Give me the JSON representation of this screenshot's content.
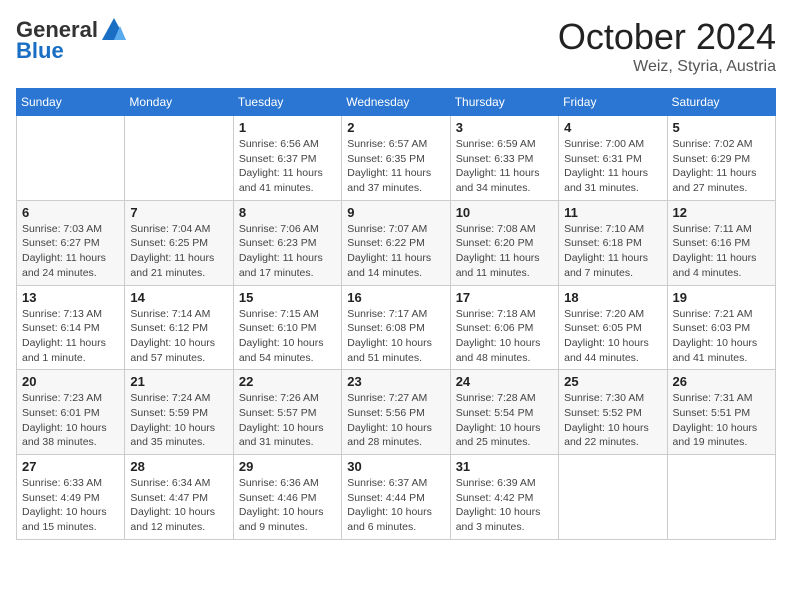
{
  "header": {
    "logo_general": "General",
    "logo_blue": "Blue",
    "month_title": "October 2024",
    "location": "Weiz, Styria, Austria"
  },
  "days_of_week": [
    "Sunday",
    "Monday",
    "Tuesday",
    "Wednesday",
    "Thursday",
    "Friday",
    "Saturday"
  ],
  "weeks": [
    [
      {
        "day": "",
        "info": ""
      },
      {
        "day": "",
        "info": ""
      },
      {
        "day": "1",
        "info": "Sunrise: 6:56 AM\nSunset: 6:37 PM\nDaylight: 11 hours and 41 minutes."
      },
      {
        "day": "2",
        "info": "Sunrise: 6:57 AM\nSunset: 6:35 PM\nDaylight: 11 hours and 37 minutes."
      },
      {
        "day": "3",
        "info": "Sunrise: 6:59 AM\nSunset: 6:33 PM\nDaylight: 11 hours and 34 minutes."
      },
      {
        "day": "4",
        "info": "Sunrise: 7:00 AM\nSunset: 6:31 PM\nDaylight: 11 hours and 31 minutes."
      },
      {
        "day": "5",
        "info": "Sunrise: 7:02 AM\nSunset: 6:29 PM\nDaylight: 11 hours and 27 minutes."
      }
    ],
    [
      {
        "day": "6",
        "info": "Sunrise: 7:03 AM\nSunset: 6:27 PM\nDaylight: 11 hours and 24 minutes."
      },
      {
        "day": "7",
        "info": "Sunrise: 7:04 AM\nSunset: 6:25 PM\nDaylight: 11 hours and 21 minutes."
      },
      {
        "day": "8",
        "info": "Sunrise: 7:06 AM\nSunset: 6:23 PM\nDaylight: 11 hours and 17 minutes."
      },
      {
        "day": "9",
        "info": "Sunrise: 7:07 AM\nSunset: 6:22 PM\nDaylight: 11 hours and 14 minutes."
      },
      {
        "day": "10",
        "info": "Sunrise: 7:08 AM\nSunset: 6:20 PM\nDaylight: 11 hours and 11 minutes."
      },
      {
        "day": "11",
        "info": "Sunrise: 7:10 AM\nSunset: 6:18 PM\nDaylight: 11 hours and 7 minutes."
      },
      {
        "day": "12",
        "info": "Sunrise: 7:11 AM\nSunset: 6:16 PM\nDaylight: 11 hours and 4 minutes."
      }
    ],
    [
      {
        "day": "13",
        "info": "Sunrise: 7:13 AM\nSunset: 6:14 PM\nDaylight: 11 hours and 1 minute."
      },
      {
        "day": "14",
        "info": "Sunrise: 7:14 AM\nSunset: 6:12 PM\nDaylight: 10 hours and 57 minutes."
      },
      {
        "day": "15",
        "info": "Sunrise: 7:15 AM\nSunset: 6:10 PM\nDaylight: 10 hours and 54 minutes."
      },
      {
        "day": "16",
        "info": "Sunrise: 7:17 AM\nSunset: 6:08 PM\nDaylight: 10 hours and 51 minutes."
      },
      {
        "day": "17",
        "info": "Sunrise: 7:18 AM\nSunset: 6:06 PM\nDaylight: 10 hours and 48 minutes."
      },
      {
        "day": "18",
        "info": "Sunrise: 7:20 AM\nSunset: 6:05 PM\nDaylight: 10 hours and 44 minutes."
      },
      {
        "day": "19",
        "info": "Sunrise: 7:21 AM\nSunset: 6:03 PM\nDaylight: 10 hours and 41 minutes."
      }
    ],
    [
      {
        "day": "20",
        "info": "Sunrise: 7:23 AM\nSunset: 6:01 PM\nDaylight: 10 hours and 38 minutes."
      },
      {
        "day": "21",
        "info": "Sunrise: 7:24 AM\nSunset: 5:59 PM\nDaylight: 10 hours and 35 minutes."
      },
      {
        "day": "22",
        "info": "Sunrise: 7:26 AM\nSunset: 5:57 PM\nDaylight: 10 hours and 31 minutes."
      },
      {
        "day": "23",
        "info": "Sunrise: 7:27 AM\nSunset: 5:56 PM\nDaylight: 10 hours and 28 minutes."
      },
      {
        "day": "24",
        "info": "Sunrise: 7:28 AM\nSunset: 5:54 PM\nDaylight: 10 hours and 25 minutes."
      },
      {
        "day": "25",
        "info": "Sunrise: 7:30 AM\nSunset: 5:52 PM\nDaylight: 10 hours and 22 minutes."
      },
      {
        "day": "26",
        "info": "Sunrise: 7:31 AM\nSunset: 5:51 PM\nDaylight: 10 hours and 19 minutes."
      }
    ],
    [
      {
        "day": "27",
        "info": "Sunrise: 6:33 AM\nSunset: 4:49 PM\nDaylight: 10 hours and 15 minutes."
      },
      {
        "day": "28",
        "info": "Sunrise: 6:34 AM\nSunset: 4:47 PM\nDaylight: 10 hours and 12 minutes."
      },
      {
        "day": "29",
        "info": "Sunrise: 6:36 AM\nSunset: 4:46 PM\nDaylight: 10 hours and 9 minutes."
      },
      {
        "day": "30",
        "info": "Sunrise: 6:37 AM\nSunset: 4:44 PM\nDaylight: 10 hours and 6 minutes."
      },
      {
        "day": "31",
        "info": "Sunrise: 6:39 AM\nSunset: 4:42 PM\nDaylight: 10 hours and 3 minutes."
      },
      {
        "day": "",
        "info": ""
      },
      {
        "day": "",
        "info": ""
      }
    ]
  ]
}
